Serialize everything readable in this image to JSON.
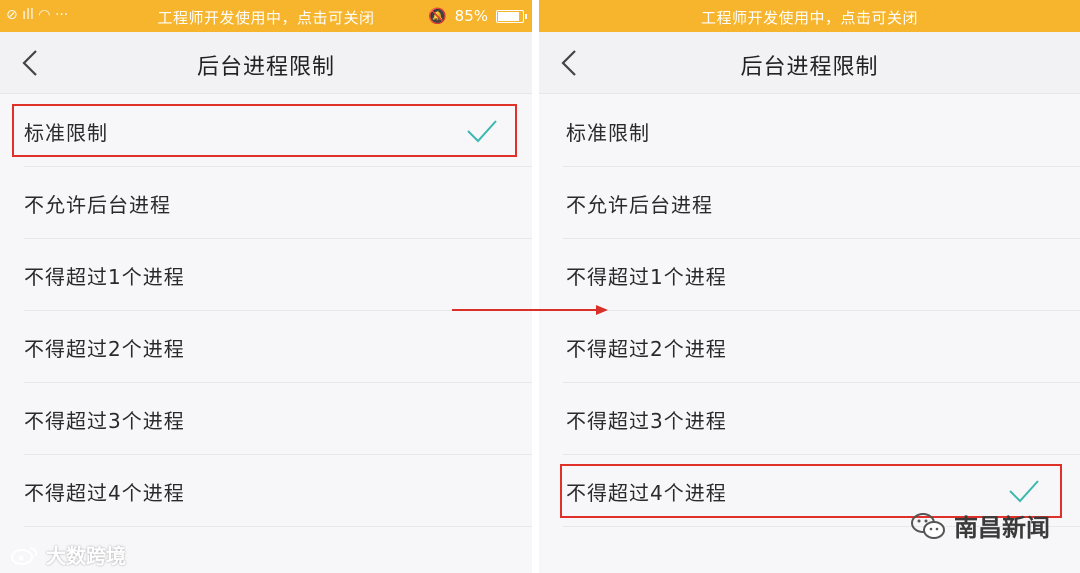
{
  "status_bar": {
    "message": "工程师开发使用中，点击可关闭",
    "left_icons": "⊘ 📶 ···",
    "battery": "85%"
  },
  "nav": {
    "title": "后台进程限制",
    "back_icon": "chevron-left-icon"
  },
  "options": [
    {
      "label": "标准限制"
    },
    {
      "label": "不允许后台进程"
    },
    {
      "label": "不得超过1个进程"
    },
    {
      "label": "不得超过2个进程"
    },
    {
      "label": "不得超过3个进程"
    },
    {
      "label": "不得超过4个进程"
    }
  ],
  "left_screen": {
    "selected_option": "标准限制"
  },
  "right_screen": {
    "selected_option": "不得超过4个进程"
  },
  "watermarks": {
    "left": "大数跨境",
    "right": "南昌新闻"
  },
  "colors": {
    "status_bar": "#f6b52c",
    "checkmark": "#3cb8b0",
    "highlight": "#e0302a"
  }
}
